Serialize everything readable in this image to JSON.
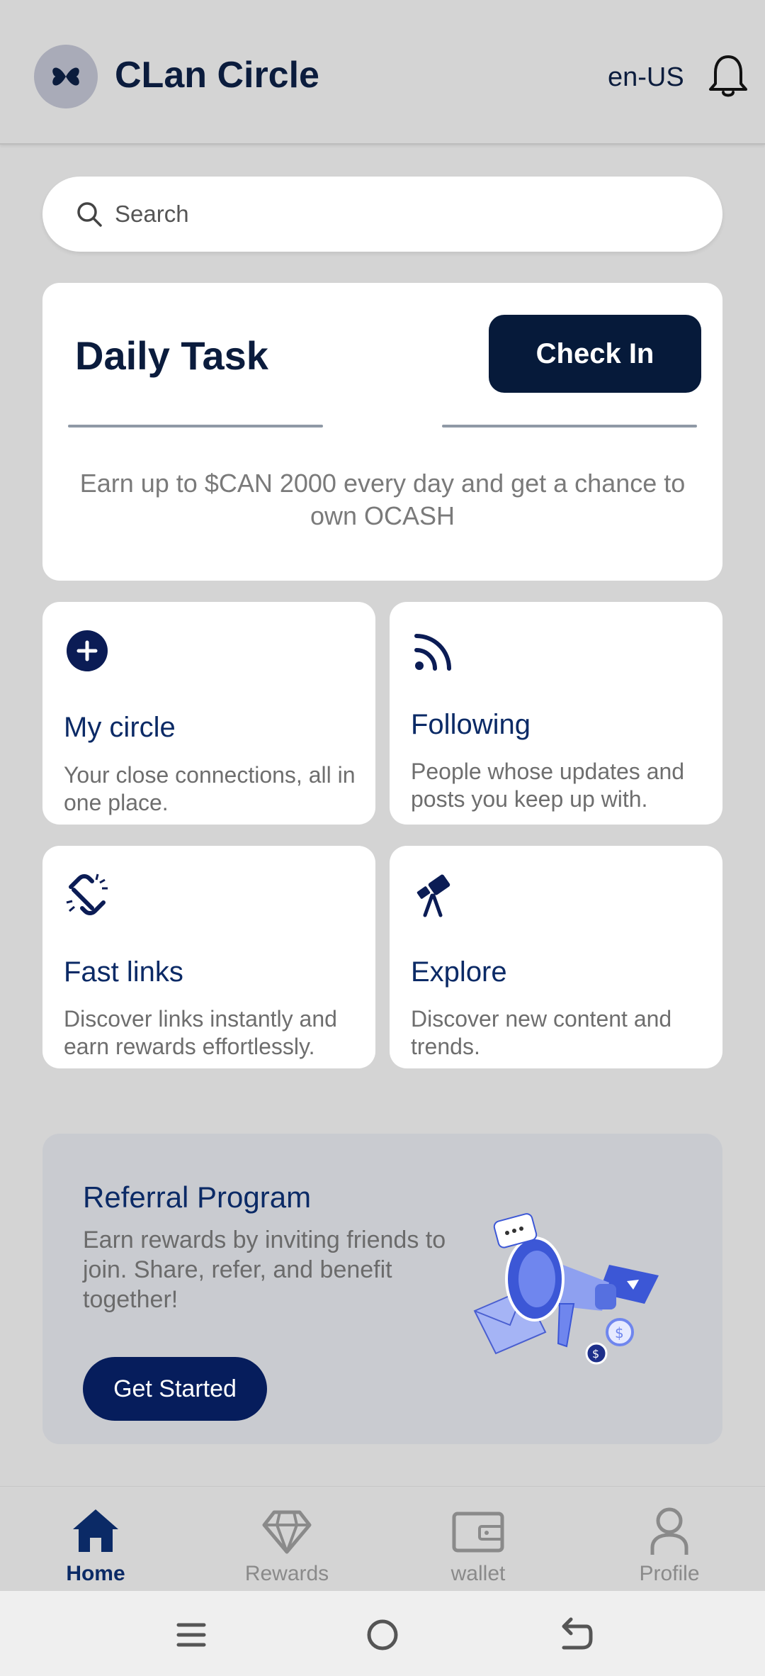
{
  "header": {
    "app_title": "CLan Circle",
    "locale": "en-US"
  },
  "search": {
    "placeholder": "Search"
  },
  "daily_task": {
    "title": "Daily Task",
    "button_label": "Check In",
    "description": "Earn up to $CAN 2000 every day and get a chance to own OCASH"
  },
  "cards": [
    {
      "title": "My circle",
      "description": "Your close connections, all in one place.",
      "icon": "plus-circle-icon"
    },
    {
      "title": "Following",
      "description": "People whose updates and posts you keep up with.",
      "icon": "rss-feed-icon"
    },
    {
      "title": "Fast links",
      "description": "Discover links instantly and earn rewards effortlessly.",
      "icon": "broken-link-icon"
    },
    {
      "title": "Explore",
      "description": "Discover new content and trends.",
      "icon": "telescope-icon"
    }
  ],
  "referral": {
    "title": "Referral Program",
    "description": "Earn rewards by inviting friends to join. Share, refer, and benefit together!",
    "button_label": "Get Started",
    "illustration": "megaphone-illustration"
  },
  "bottom_nav": [
    {
      "label": "Home",
      "icon": "home-icon",
      "active": true
    },
    {
      "label": "Rewards",
      "icon": "diamond-icon",
      "active": false
    },
    {
      "label": "wallet",
      "icon": "wallet-icon",
      "active": false
    },
    {
      "label": "Profile",
      "icon": "person-icon",
      "active": false
    }
  ],
  "colors": {
    "primary": "#061a3a",
    "accent_blue": "#0b2a66",
    "background": "#d4d4d4",
    "card": "#ffffff",
    "muted_text": "#7a7a7a"
  }
}
